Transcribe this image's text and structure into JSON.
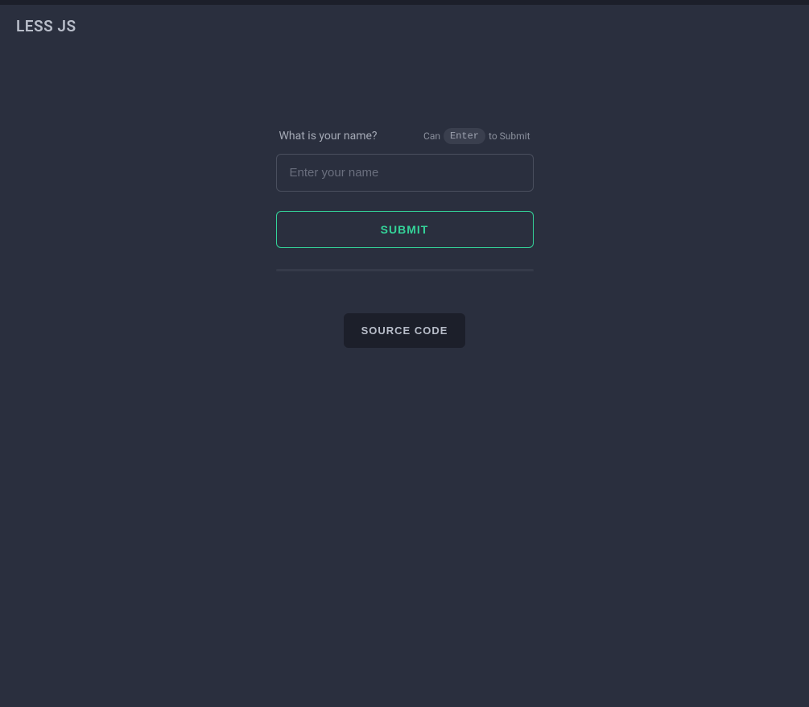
{
  "header": {
    "brand": "LESS JS"
  },
  "form": {
    "question_label": "What is your name?",
    "hint_prefix": "Can",
    "hint_key": "Enter",
    "hint_suffix": "to Submit",
    "input_placeholder": "Enter your name",
    "input_value": "",
    "submit_label": "SUBMIT"
  },
  "footer": {
    "source_code_label": "SOURCE CODE"
  }
}
